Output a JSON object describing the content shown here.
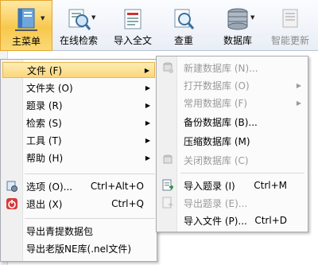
{
  "toolbar": {
    "main_menu": "主菜单",
    "online_search": "在线检索",
    "import_fulltext": "导入全文",
    "dedupe": "查重",
    "database": "数据库",
    "smart_update": "智能更新"
  },
  "menu": {
    "file": "文件 (F)",
    "folder": "文件夹 (O)",
    "records": "题录 (R)",
    "search": "检索 (S)",
    "tools": "工具 (T)",
    "help": "帮助 (H)",
    "options": "选项 (O)...",
    "options_shortcut": "Ctrl+Alt+O",
    "exit": "退出 (X)",
    "exit_shortcut": "Ctrl+Q",
    "export_qingti": "导出青提数据包",
    "export_old_ne": "导出老版NE库(.nel文件)"
  },
  "submenu": {
    "new_db": "新建数据库 (N)...",
    "open_db": "打开数据库 (O)",
    "common_db": "常用数据库 (F)",
    "backup_db": "备份数据库 (B)...",
    "compress_db": "压缩数据库 (M)",
    "close_db": "关闭数据库 (C)",
    "import_records": "导入题录 (I)",
    "import_records_shortcut": "Ctrl+M",
    "export_records": "导出题录 (E)...",
    "import_file": "导入文件 (P)...",
    "import_file_shortcut": "Ctrl+D"
  },
  "colors": {
    "highlight": "#fbd67a",
    "main_button": "#f8c84c"
  }
}
